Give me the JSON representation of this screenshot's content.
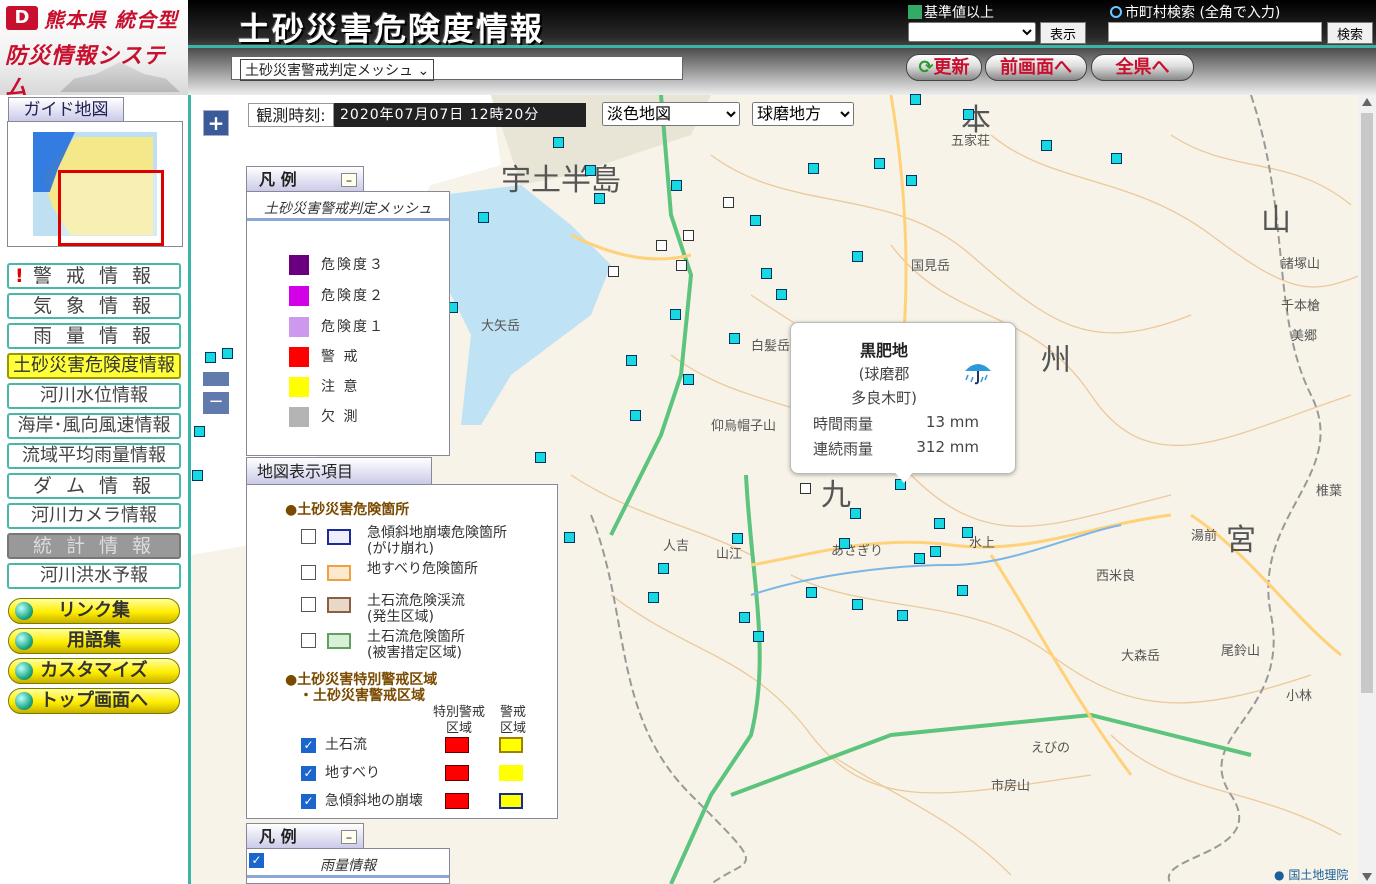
{
  "header": {
    "logo_line1": "熊本県 統合型",
    "logo_line2": "防災情報システム",
    "logo_mark": "D",
    "title": "土砂災害危険度情報",
    "kijun_label": "基準値以上",
    "kijun_selected": "",
    "show_button": "表示",
    "search_label": "市町村検索 (全角で入力)",
    "search_value": "",
    "search_button": "検索",
    "mesh_select": "土砂災害警戒判定メッシュ",
    "refresh_button": "更新",
    "prev_button": "前画面へ",
    "all_button": "全県へ"
  },
  "sidebar": {
    "guide_tab": "ガイド地図",
    "nav": [
      {
        "label": "警 戒 情 報",
        "state": "normal",
        "alert": "!"
      },
      {
        "label": "気 象 情 報",
        "state": "normal"
      },
      {
        "label": "雨 量 情 報",
        "state": "normal"
      },
      {
        "label": "土砂災害危険度情報",
        "state": "active"
      },
      {
        "label": "河川水位情報",
        "state": "normal"
      },
      {
        "label": "海岸･風向風速情報",
        "state": "normal"
      },
      {
        "label": "流域平均雨量情報",
        "state": "normal"
      },
      {
        "label": "ダ ム 情 報",
        "state": "normal"
      },
      {
        "label": "河川カメラ情報",
        "state": "normal"
      },
      {
        "label": "統 計 情 報",
        "state": "disabled"
      },
      {
        "label": "河川洪水予報",
        "state": "normal"
      }
    ],
    "links": [
      "リンク集",
      "用語集",
      "カスタマイズ",
      "トップ画面へ"
    ]
  },
  "map": {
    "zoom_in": "+",
    "obs_time_label": "観測時刻:",
    "obs_time_value": "2020年07月07日 12時20分",
    "basemap_select": "淡色地図",
    "area_select": "球磨地方",
    "labels": [
      "宇土半島",
      "本",
      "九",
      "州",
      "山",
      "宮",
      "国見岳",
      "五家荘",
      "大矢岳",
      "白髪岳",
      "仰烏帽子山",
      "人吉",
      "山江",
      "あさぎり",
      "水上",
      "湯前",
      "西米良",
      "えびの",
      "市房山",
      "諸塚山",
      "千本槍",
      "美郷",
      "椎葉",
      "尾鈴山",
      "大森岳",
      "小林"
    ],
    "attribution": "国土地理院"
  },
  "legend_mesh": {
    "tab": "凡 例",
    "subtitle": "土砂災害警戒判定メッシュ",
    "items": [
      {
        "label": "危険度３",
        "color": "#6a0080"
      },
      {
        "label": "危険度２",
        "color": "#d200e6"
      },
      {
        "label": "危険度１",
        "color": "#cc99ee"
      },
      {
        "label": "警 戒",
        "color": "#ff0000"
      },
      {
        "label": "注 意",
        "color": "#ffff00"
      },
      {
        "label": "欠 測",
        "color": "#b4b4b4"
      }
    ]
  },
  "legend_items": {
    "tab": "地図表示項目",
    "section1": "●土砂災害危険箇所",
    "hazards": [
      {
        "line1": "急傾斜地崩壊危険箇所",
        "line2": "(がけ崩れ)",
        "border": "#1a2a9a",
        "fill": "#eef"
      },
      {
        "line1": "地すべり危険箇所",
        "line2": "",
        "border": "#f0a040",
        "fill": "#fde8d0"
      },
      {
        "line1": "土石流危険渓流",
        "line2": "(発生区域)",
        "border": "#8a6040",
        "fill": "#e8d8c8"
      },
      {
        "line1": "土石流危険箇所",
        "line2": "(被害措定区域)",
        "border": "#60a060",
        "fill": "#d8f0d8"
      }
    ],
    "section2a": "●土砂災害特別警戒区域",
    "section2b": "・土砂災害警戒区域",
    "col1_line1": "特別警戒",
    "col1_line2": "区域",
    "col2_line1": "警戒",
    "col2_line2": "区域",
    "zones": [
      {
        "label": "土石流",
        "special": "#ff0000",
        "warn": "#ffff00",
        "warn_border": "#a08000"
      },
      {
        "label": "地すべり",
        "special": "#ff0000",
        "warn": "#ffff00",
        "warn_border": "#ffff00"
      },
      {
        "label": "急傾斜地の崩壊",
        "special": "#ff0000",
        "warn": "#ffff00",
        "warn_border": "#1a2a9a"
      }
    ]
  },
  "legend_rain": {
    "tab": "凡 例",
    "subtitle": "雨量情報"
  },
  "popup": {
    "name": "黒肥地",
    "district": "(球磨郡",
    "town": "多良木町)",
    "hourly_label": "時間雨量",
    "hourly_value": "13 mm",
    "cumulative_label": "連続雨量",
    "cumulative_value": "312 mm",
    "icon": "rain-umbrella-icon"
  }
}
